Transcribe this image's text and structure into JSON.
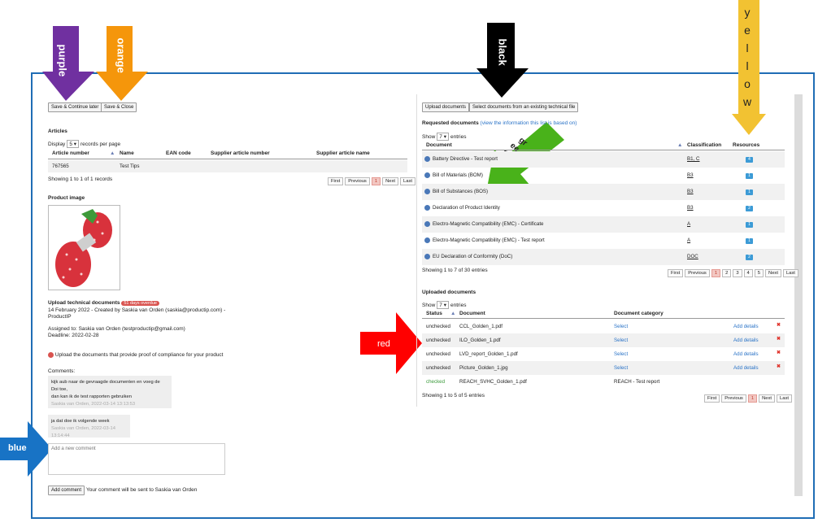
{
  "annotations": {
    "purple": "purple",
    "orange": "orange",
    "black": "black",
    "yellow": [
      "y",
      "e",
      "l",
      "l",
      "o",
      "w"
    ],
    "green": [
      "gr",
      "ee",
      "n"
    ],
    "red": "red",
    "blue": "blue"
  },
  "colors": {
    "frame": "#1f6db5",
    "purple": "#7030a0",
    "orange": "#f5960b",
    "black": "#000000",
    "yellow": "#f2c232",
    "green": "#49b21a",
    "red": "#ff0000",
    "blue": "#1873c5"
  },
  "toolbar": {
    "save_continue": "Save & Continue later",
    "save_close": "Save & Close"
  },
  "articles": {
    "title": "Articles",
    "display": "Display",
    "per_page_value": "5",
    "per_page_suffix": "records per page",
    "columns": [
      "Article number",
      "Name",
      "EAN code",
      "Supplier article number",
      "Supplier article name"
    ],
    "rows": [
      [
        "767565",
        "Test Tips",
        "",
        "",
        ""
      ]
    ],
    "summary": "Showing 1 to 1 of 1 records",
    "pager": [
      "First",
      "Previous",
      "1",
      "Next",
      "Last"
    ]
  },
  "product_image": {
    "title": "Product image",
    "icon": "strawberry-usb-image"
  },
  "upload": {
    "title": "Upload technical documents",
    "badge": "51 days overdue",
    "created": "14 February 2022 - Created by Saskia van Orden (saskia@productip.com) -",
    "company": "ProductIP",
    "assigned": "Assigned to: Saskia van Orden (testproductip@gmail.com)",
    "deadline": "Deadline: 2022-02-28",
    "notice": "Upload the documents that provide proof of compliance for your product"
  },
  "comments": {
    "label": "Comments:",
    "items": [
      {
        "text1": "kijk aub naar de gevraagde documenten en voeg de Doi toe,",
        "text2": "dan kan ik de test rapporten gebruiken",
        "meta": "Saskia van Orden, 2022-03-14 13:13:53"
      },
      {
        "text1": "ja dat doe ik volgende week",
        "text2": "",
        "meta": "Saskia van Orden, 2022-03-14 13:14:44"
      }
    ],
    "placeholder": "Add a new comment",
    "add_button": "Add comment",
    "note": "Your comment will be sent to Saskia van Orden"
  },
  "right_tabs": {
    "upload": "Upload documents",
    "select": "Select documents from an existing technical file"
  },
  "requested": {
    "title": "Requested documents",
    "link": "(view the information this list is based on)",
    "show": "Show",
    "entries_value": "7",
    "entries": "entries",
    "columns": [
      "Document",
      "Classification",
      "Resources"
    ],
    "rows": [
      {
        "doc": "Battery Directive - Test report",
        "cls": "B1, C",
        "res": "4"
      },
      {
        "doc": "Bill of Materials (BOM)",
        "cls": "B3",
        "res": "1"
      },
      {
        "doc": "Bill of Substances (BOS)",
        "cls": "B3",
        "res": "1"
      },
      {
        "doc": "Declaration of Product Identity",
        "cls": "B3",
        "res": "2"
      },
      {
        "doc": "Electro-Magnetic Compatibility (EMC) - Certificate",
        "cls": "A",
        "res": "1"
      },
      {
        "doc": "Electro-Magnetic Compatibility (EMC) - Test report",
        "cls": "A",
        "res": "1"
      },
      {
        "doc": "EU Declaration of Conformity (DoC)",
        "cls": "DOC",
        "res": "2"
      }
    ],
    "summary": "Showing 1 to 7 of 30 entries",
    "pager": [
      "First",
      "Previous",
      "1",
      "2",
      "3",
      "4",
      "5",
      "Next",
      "Last"
    ]
  },
  "uploaded": {
    "title": "Uploaded documents",
    "show": "Show",
    "entries_value": "7",
    "entries": "entries",
    "columns": [
      "Status",
      "Document",
      "Document category"
    ],
    "rows": [
      {
        "status": "unchecked",
        "doc": "CCL_Golden_1.pdf",
        "cat": "Select",
        "details": "Add details"
      },
      {
        "status": "unchecked",
        "doc": "ILO_Golden_1.pdf",
        "cat": "Select",
        "details": "Add details"
      },
      {
        "status": "unchecked",
        "doc": "LVD_report_Golden_1.pdf",
        "cat": "Select",
        "details": "Add details"
      },
      {
        "status": "unchecked",
        "doc": "Picture_Golden_1.jpg",
        "cat": "Select",
        "details": "Add details"
      },
      {
        "status": "checked",
        "doc": "REACH_SVHC_Golden_1.pdf",
        "cat": "REACH - Test report",
        "details": ""
      }
    ],
    "summary": "Showing 1 to 5 of 5 entries",
    "pager": [
      "First",
      "Previous",
      "1",
      "Next",
      "Last"
    ]
  }
}
